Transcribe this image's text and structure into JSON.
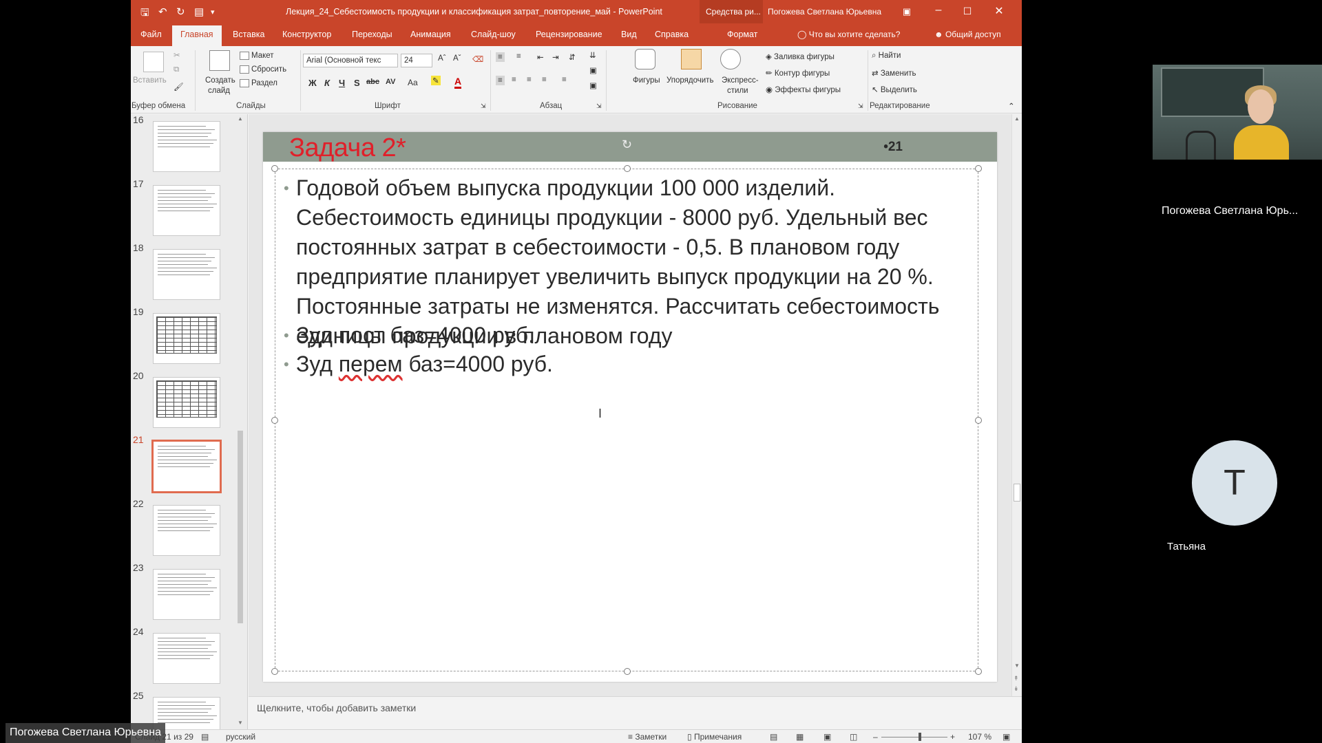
{
  "titlebar": {
    "document_title": "Лекция_24_Себестоимость продукции и классификация затрат_повторение_май  -  PowerPoint",
    "context_tab": "Средства ри...",
    "user": "Погожева Светлана Юрьевна"
  },
  "tabs": [
    "Файл",
    "Главная",
    "Вставка",
    "Конструктор",
    "Переходы",
    "Анимация",
    "Слайд-шоу",
    "Рецензирование",
    "Вид",
    "Справка"
  ],
  "format_tab": "Формат",
  "tell_me": "Что вы хотите сделать?",
  "share": "Общий доступ",
  "ribbon": {
    "clipboard": {
      "paste": "Вставить",
      "label": "Буфер обмена"
    },
    "slides": {
      "new_slide_1": "Создать",
      "new_slide_2": "слайд",
      "layout": "Макет",
      "reset": "Сбросить",
      "section": "Раздел",
      "label": "Слайды"
    },
    "font": {
      "name": "Arial (Основной текс",
      "size": "24",
      "label": "Шрифт",
      "bold": "Ж",
      "italic": "К",
      "underline": "Ч",
      "shadow": "S",
      "strike": "abc",
      "spacing": "AV",
      "case": "Aa"
    },
    "paragraph": {
      "label": "Абзац"
    },
    "drawing": {
      "shapes": "Фигуры",
      "arrange": "Упорядочить",
      "quick_styles_1": "Экспресс-",
      "quick_styles_2": "стили",
      "fill": "Заливка фигуры",
      "outline": "Контур фигуры",
      "effects": "Эффекты фигуры",
      "label": "Рисование"
    },
    "editing": {
      "find": "Найти",
      "replace": "Заменить",
      "select": "Выделить",
      "label": "Редактирование"
    }
  },
  "thumbnails": [
    {
      "num": "16",
      "kind": "text"
    },
    {
      "num": "17",
      "kind": "text"
    },
    {
      "num": "18",
      "kind": "text"
    },
    {
      "num": "19",
      "kind": "table"
    },
    {
      "num": "20",
      "kind": "table"
    },
    {
      "num": "21",
      "kind": "text",
      "active": true
    },
    {
      "num": "22",
      "kind": "text"
    },
    {
      "num": "23",
      "kind": "text"
    },
    {
      "num": "24",
      "kind": "text"
    },
    {
      "num": "25",
      "kind": "text"
    }
  ],
  "slide": {
    "title": "Задача 2*",
    "number": "•21",
    "bullets": [
      "Годовой объем выпуска продукции 100 000 изделий. Себестоимость единицы продукции - 8000 руб. Удельный вес постоянных затрат в себестоимости - 0,5. В плановом году предприятие планирует увеличить выпуск продукции на 20 %. Постоянные затраты не изменятся. Рассчитать себестоимость единицы продукции в плановом году",
      "Зуд пост баз=4000 руб."
    ],
    "bullet3_word1": "Зуд",
    "bullet3_word2": "перем",
    "bullet3_rest": "баз=4000 руб."
  },
  "notes_placeholder": "Щелкните, чтобы добавить заметки",
  "status": {
    "slide_of": "Слайд 21 из 29",
    "language": "русский",
    "notes": "Заметки",
    "comments": "Примечания",
    "zoom": "107 %"
  },
  "call": {
    "video_participant": "Погожева Светлана Юрь...",
    "avatar_letter": "Т",
    "avatar_participant": "Татьяна",
    "presenter_label": "Погожева Светлана Юрьевна"
  },
  "colors": {
    "accent": "#c9452a",
    "slide_header": "#8f9b8f",
    "slide_title": "#e0202a"
  }
}
